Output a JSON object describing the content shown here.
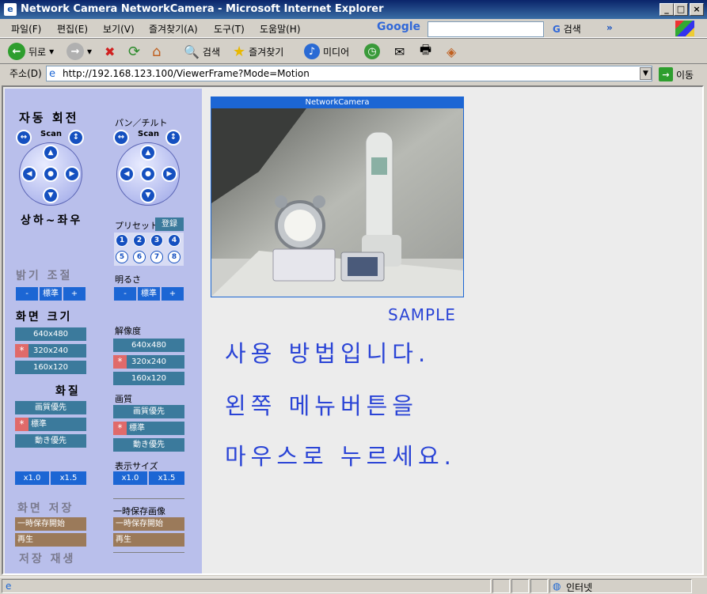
{
  "window": {
    "title": "Network Camera NetworkCamera - Microsoft Internet Explorer",
    "controls": [
      "_",
      "□",
      "×"
    ]
  },
  "menu": {
    "items": [
      "파일(F)",
      "편집(E)",
      "보기(V)",
      "즐겨찾기(A)",
      "도구(T)",
      "도움말(H)"
    ],
    "google_label": "Google",
    "google_search_label": "검색",
    "google_more": "»"
  },
  "toolbar": {
    "back": "뒤로",
    "search": "검색",
    "favorites": "즐겨찾기",
    "media": "미디어"
  },
  "address": {
    "label": "주소(D)",
    "url": "http://192.168.123.100/ViewerFrame?Mode=Motion",
    "go": "이동"
  },
  "left_panel": {
    "auto_rotate": "자동 회전",
    "scan": "Scan",
    "up_down_left_right": "상하~좌우",
    "pan_tilt": "パン／チルト",
    "preset": "プリセット",
    "register": "登録",
    "preset_numbers": [
      "1",
      "2",
      "3",
      "4",
      "5",
      "6",
      "7",
      "8"
    ],
    "brightness_kor": "밝기 조절",
    "brightness_jp": "明るさ",
    "minus": "-",
    "standard": "標準",
    "plus": "+",
    "screen_size_kor": "화면 크기",
    "resolution_jp": "解像度",
    "resolutions": [
      "640x480",
      "320x240",
      "160x120"
    ],
    "quality_kor": "화질",
    "quality_jp": "画質",
    "qualities": [
      "画質優先",
      "標準",
      "動き優先"
    ],
    "display_size_jp": "表示サイズ",
    "zoom": [
      "x1.0",
      "x1.5"
    ],
    "save_kor": "화면 저장",
    "temp_save_jp": "一時保存画像",
    "temp_save_start": "一時保存開始",
    "play": "再生",
    "save_play_kor": "저장 재생",
    "selected_marker": "*"
  },
  "camera": {
    "title": "NetworkCamera"
  },
  "sample_label": "SAMPLE",
  "messages": [
    "사용 방법입니다.",
    "왼쪽 메뉴버튼을",
    "마우스로 누르세요."
  ],
  "status": {
    "zone": "인터넷"
  }
}
